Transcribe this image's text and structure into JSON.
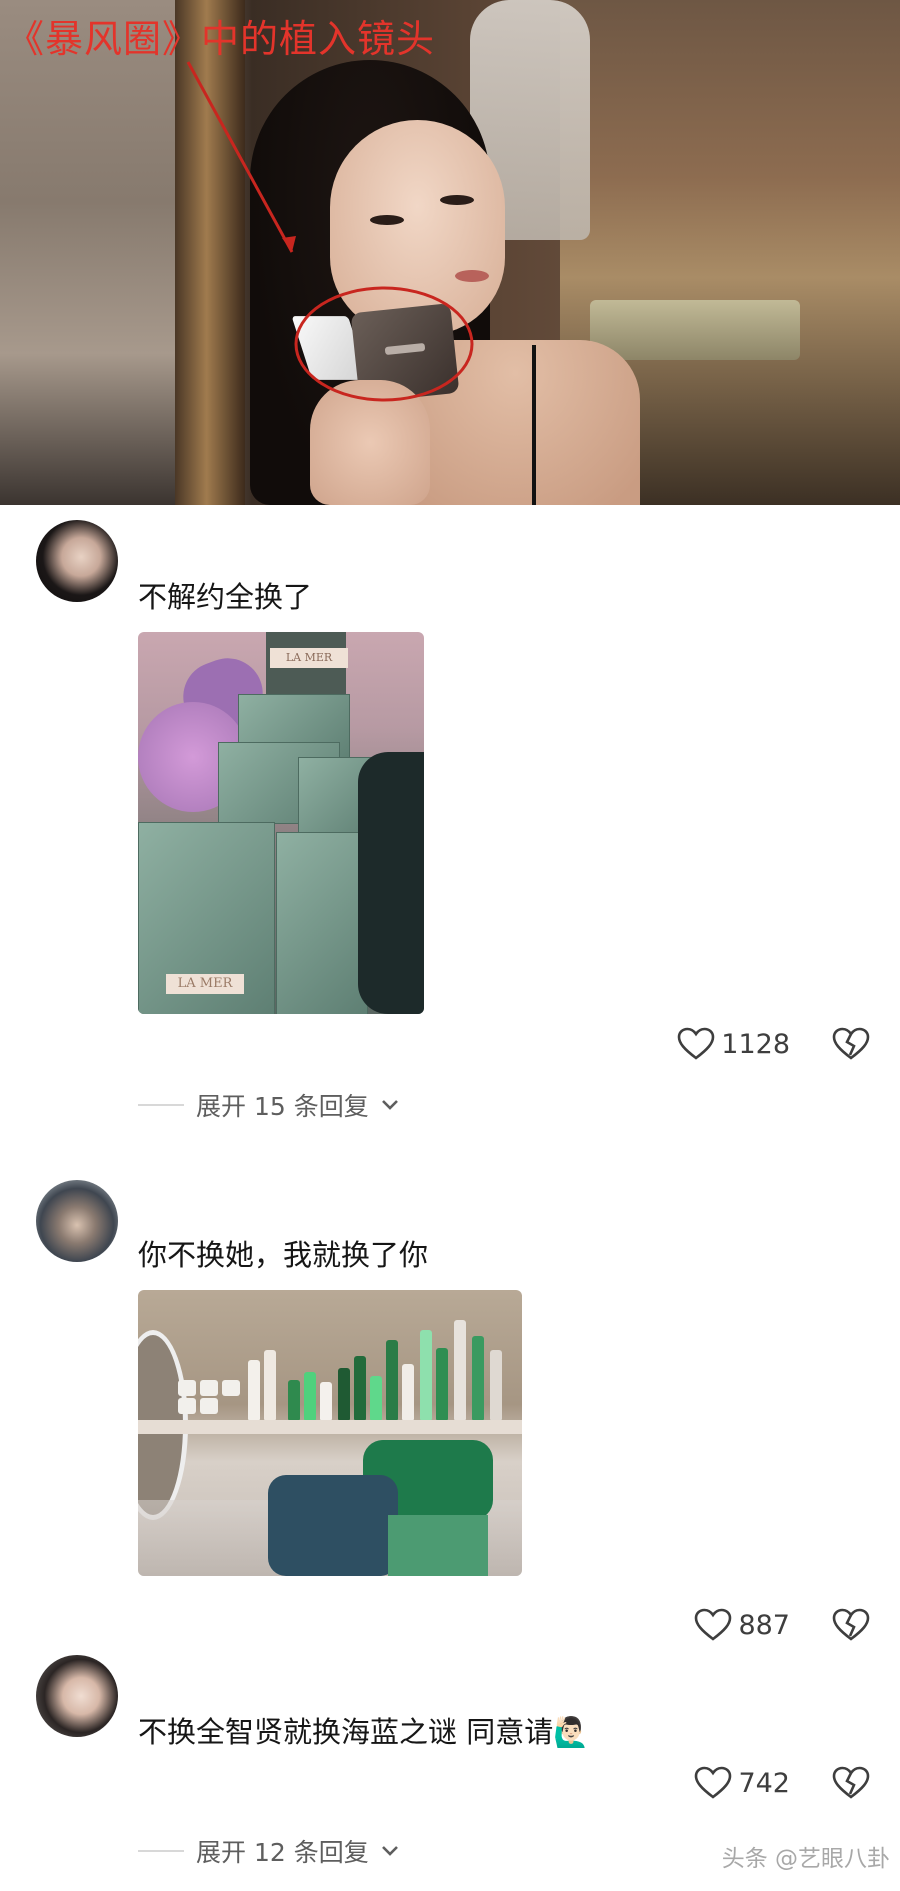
{
  "hero": {
    "caption": "《暴风圈》中的植入镜头",
    "accent_color": "#e3342b"
  },
  "comments": [
    {
      "text": "不解约全换了",
      "likes": "1128",
      "expand_label": "展开 15 条回复"
    },
    {
      "text": "你不换她，我就换了你",
      "likes": "887"
    },
    {
      "text": "不换全智贤就换海蓝之谜 同意请🙋🏻‍♂️",
      "likes": "742",
      "expand_label": "展开 12 条回复"
    }
  ],
  "photo1": {
    "label_top": "LA MER",
    "label_front": "LA MER"
  },
  "icons": {
    "like": "heart-outline-icon",
    "dislike": "broken-heart-icon",
    "expand": "chevron-down-icon"
  },
  "watermark": "头条 @艺眼八卦"
}
